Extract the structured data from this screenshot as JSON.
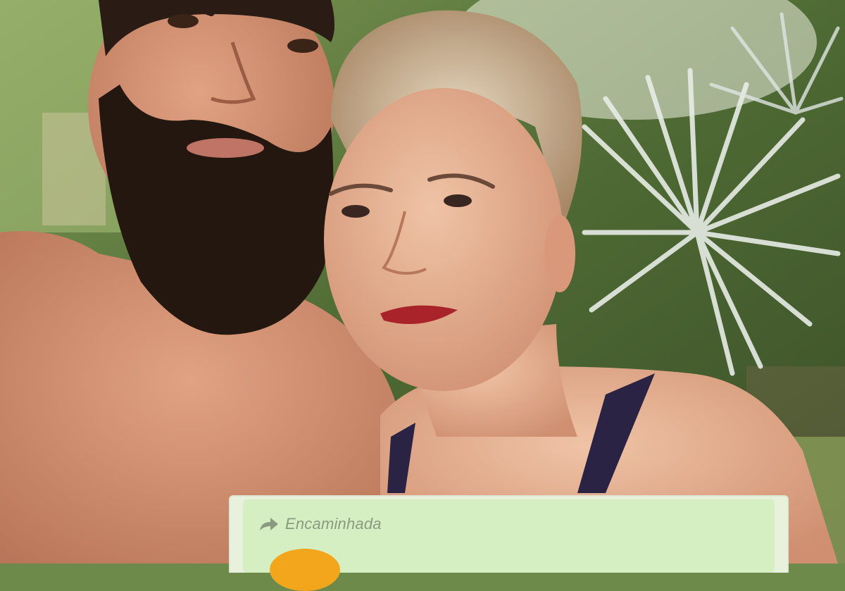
{
  "message_card": {
    "forwarded_label": "Encaminhada",
    "forwarded_icon": "forward-arrow-icon",
    "accent_color": "#f3a51b",
    "bubble_color": "#d6efc2"
  }
}
